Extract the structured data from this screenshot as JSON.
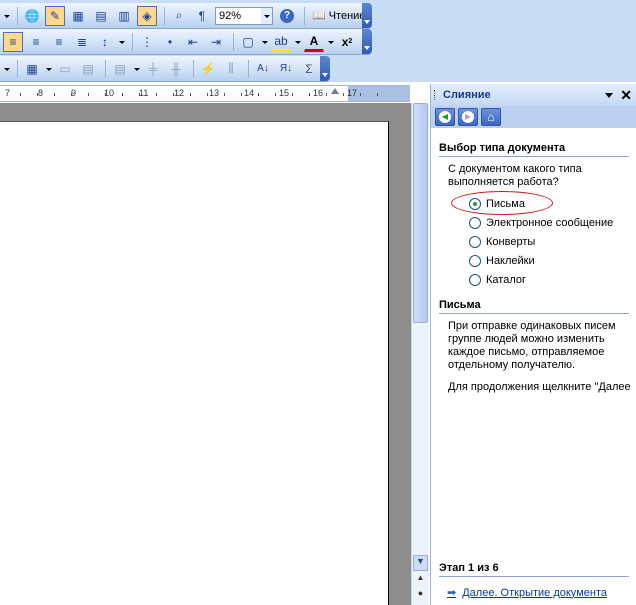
{
  "toolbar": {
    "zoom_value": "92%",
    "reading_label": "Чтение",
    "pilcrow": "¶",
    "help_glyph": "?",
    "increase_indent_glyph": "A",
    "font_color_glyph": "A",
    "sigma_glyph": "Σ",
    "close_glyph": "×",
    "colors": {
      "pressed": "#ffd68a",
      "accent": "#2d5bb8"
    }
  },
  "ruler": {
    "labels": [
      "7",
      "8",
      "9",
      "10",
      "11",
      "12",
      "13",
      "14",
      "15",
      "16",
      "17"
    ]
  },
  "task_pane": {
    "title": "Слияние",
    "close_glyph": "✕",
    "nav": {
      "back_glyph": "◀",
      "forward_glyph": "▶",
      "home_glyph": "⌂"
    },
    "section1_title": "Выбор типа документа",
    "question": "С документом какого типа выполняется работа?",
    "options": [
      {
        "label": "Письма",
        "checked": true
      },
      {
        "label": "Электронное сообщение",
        "checked": false
      },
      {
        "label": "Конверты",
        "checked": false
      },
      {
        "label": "Наклейки",
        "checked": false
      },
      {
        "label": "Каталог",
        "checked": false
      }
    ],
    "section2_title": "Письма",
    "info_text": "При отправке одинаковых писем группе людей можно изменить каждое письмо, отправляемое отдельному получателю.",
    "continue_text": "Для продолжения щелкните \"Далее",
    "step_text": "Этап 1 из 6",
    "next_link": "Далее. Открытие документа",
    "highlight_color": "#d21818"
  }
}
